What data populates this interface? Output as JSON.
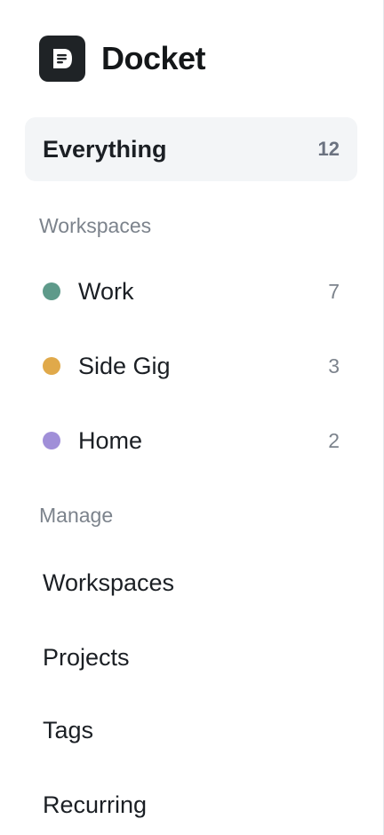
{
  "brand": {
    "name": "Docket",
    "logo_icon": "document-icon"
  },
  "everything": {
    "label": "Everything",
    "count": "12"
  },
  "workspaces_section": {
    "heading": "Workspaces",
    "items": [
      {
        "label": "Work",
        "count": "7",
        "color": "#5e9a8a"
      },
      {
        "label": "Side Gig",
        "count": "3",
        "color": "#e0a94a"
      },
      {
        "label": "Home",
        "count": "2",
        "color": "#a08fd8"
      }
    ]
  },
  "manage_section": {
    "heading": "Manage",
    "items": [
      {
        "label": "Workspaces"
      },
      {
        "label": "Projects"
      },
      {
        "label": "Tags"
      },
      {
        "label": "Recurring"
      }
    ]
  },
  "colors": {
    "active_bg": "#f3f5f7",
    "logo_bg": "#1f2326"
  }
}
